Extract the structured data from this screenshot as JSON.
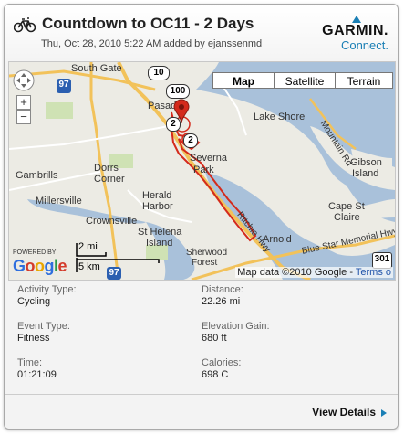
{
  "header": {
    "title": "Countdown to OC11 - 2 Days",
    "meta": "Thu, Oct 28, 2010 5:22 AM added by ejanssenmd",
    "logo_main": "GARMIN.",
    "logo_sub": "Connect."
  },
  "map": {
    "types": {
      "map": "Map",
      "satellite": "Satellite",
      "terrain": "Terrain"
    },
    "places": {
      "south_gate": "South Gate",
      "lake_shore": "Lake Shore",
      "mountain_rd": "Mountain Rd",
      "pasad": "Pasad",
      "severna": "Severna",
      "park": "Park",
      "gambrills": "Gambrills",
      "dorrs": "Dorrs",
      "corner": "Corner",
      "gibson": "Gibson",
      "island": "Island",
      "millersville": "Millersville",
      "herald": "Herald",
      "harbor": "Harbor",
      "cape_st": "Cape St",
      "claire": "Claire",
      "ritchie_hwy": "Ritchie Hwy",
      "crownsville": "Crownsville",
      "st_helena": "St Helena",
      "island2": "Island",
      "sherwood": "Sherwood",
      "forest": "Forest",
      "arnold": "Arnold",
      "blue_star": "Blue Star Memorial Hwy"
    },
    "shields": {
      "r10": "10",
      "r100": "100",
      "r97": "97",
      "r97b": "97",
      "r2a": "2",
      "r2b": "2",
      "r301": "301"
    },
    "scale_mi": "2 mi",
    "scale_km": "5 km",
    "powered_by": "POWERED BY",
    "google": "Google",
    "copyright": "Map data ©2010 Google -",
    "terms": "Terms o"
  },
  "stats": {
    "activity_type_label": "Activity Type:",
    "activity_type": "Cycling",
    "distance_label": "Distance:",
    "distance": "22.26 mi",
    "event_type_label": "Event Type:",
    "event_type": "Fitness",
    "elevation_label": "Elevation Gain:",
    "elevation": "680 ft",
    "time_label": "Time:",
    "time": "01:21:09",
    "calories_label": "Calories:",
    "calories": "698 C"
  },
  "footer": {
    "view_details": "View Details"
  },
  "colors": {
    "accent": "#1a7fb5",
    "route": "#d42a1c",
    "highway": "#f2c25a",
    "water": "#a9c1da"
  }
}
